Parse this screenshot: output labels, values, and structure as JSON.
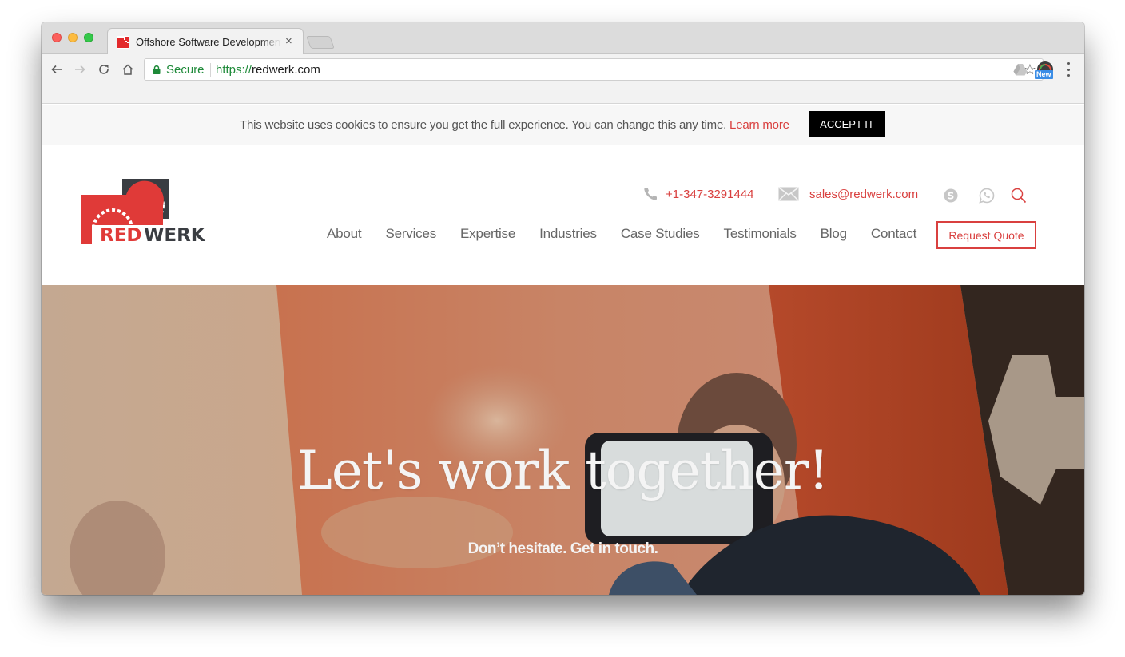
{
  "browser": {
    "tab_title": "Offshore Software Development",
    "tab_close": "×",
    "secure_label": "Secure",
    "url_scheme": "https://",
    "url_host": "redwerk.com",
    "new_badge": "New",
    "icons": {
      "back": "back-arrow-icon",
      "forward": "forward-arrow-icon",
      "reload": "reload-icon",
      "home": "home-icon",
      "lock": "lock-icon",
      "bookmark": "star-icon",
      "drive": "google-drive-icon",
      "extension": "speedometer-extension-icon",
      "menu": "kebab-menu-icon"
    }
  },
  "cookie_banner": {
    "text": "This website uses cookies to ensure you get the full experience. You can change this any time.",
    "learn_more": "Learn more",
    "accept": "ACCEPT IT"
  },
  "header": {
    "logo": {
      "red": "RED",
      "dark": "WERK"
    },
    "phone": "+1-347-3291444",
    "email": "sales@redwerk.com",
    "social_icons": [
      "skype-icon",
      "whatsapp-icon",
      "search-icon"
    ],
    "nav": [
      {
        "label": "About"
      },
      {
        "label": "Services"
      },
      {
        "label": "Expertise"
      },
      {
        "label": "Industries"
      },
      {
        "label": "Case Studies"
      },
      {
        "label": "Testimonials"
      },
      {
        "label": "Blog"
      },
      {
        "label": "Contact"
      }
    ],
    "cta": "Request Quote"
  },
  "hero": {
    "title": "Let's work together!",
    "subtitle": "Don’t hesitate. Get in touch."
  },
  "colors": {
    "brand_red": "#d9403f",
    "brand_dark": "#3a3d42",
    "secure_green": "#1e8a39"
  }
}
